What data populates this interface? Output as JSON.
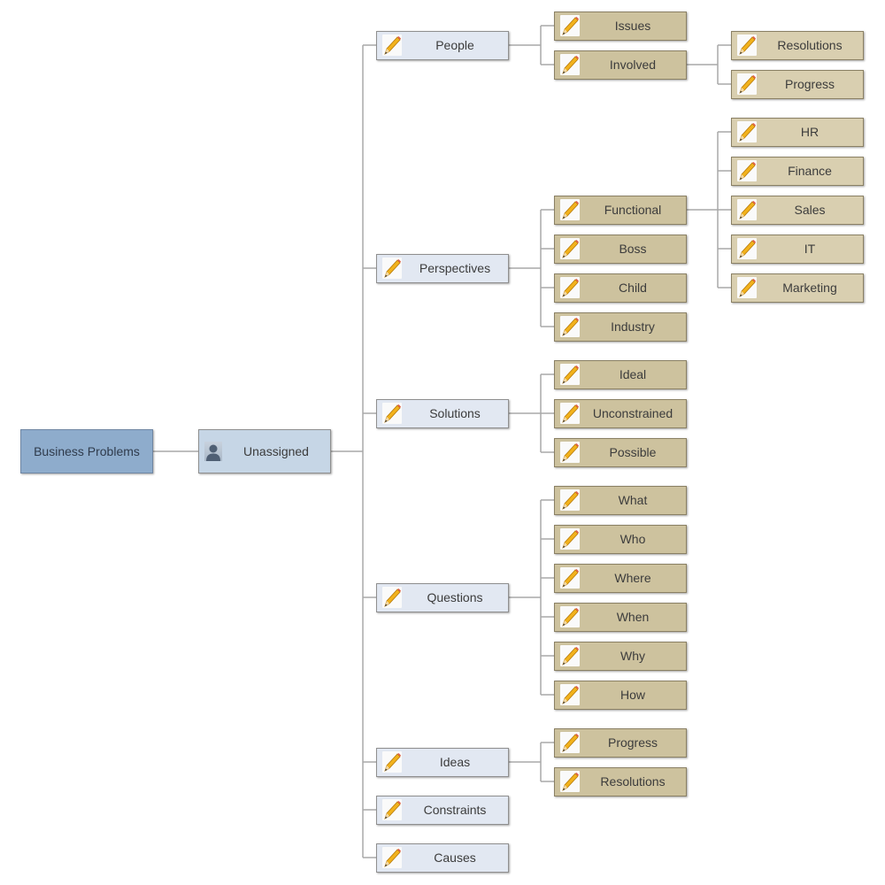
{
  "colors": {
    "root": "#8eaccc",
    "unassigned": "#c6d6e6",
    "branch": "#e2e8f2",
    "subtopic": "#cdc29e",
    "subsubtopic": "#d9cfb0",
    "connector": "#a8a8a8"
  },
  "root": {
    "label": "Business Problems"
  },
  "hub": {
    "label": "Unassigned",
    "icon": "person-icon"
  },
  "branches": [
    {
      "label": "People",
      "icon": "pencil-icon",
      "children": [
        {
          "label": "Issues"
        },
        {
          "label": "Involved",
          "children": [
            {
              "label": "Resolutions"
            },
            {
              "label": "Progress"
            }
          ]
        }
      ]
    },
    {
      "label": "Perspectives",
      "icon": "pencil-icon",
      "children": [
        {
          "label": "Functional",
          "children": [
            {
              "label": "HR"
            },
            {
              "label": "Finance"
            },
            {
              "label": "Sales"
            },
            {
              "label": "IT"
            },
            {
              "label": "Marketing"
            }
          ]
        },
        {
          "label": "Boss"
        },
        {
          "label": "Child"
        },
        {
          "label": "Industry"
        }
      ]
    },
    {
      "label": "Solutions",
      "icon": "pencil-icon",
      "children": [
        {
          "label": "Ideal"
        },
        {
          "label": "Unconstrained"
        },
        {
          "label": "Possible"
        }
      ]
    },
    {
      "label": "Questions",
      "icon": "pencil-icon",
      "children": [
        {
          "label": "What"
        },
        {
          "label": "Who"
        },
        {
          "label": "Where"
        },
        {
          "label": "When"
        },
        {
          "label": "Why"
        },
        {
          "label": "How"
        }
      ]
    },
    {
      "label": "Ideas",
      "icon": "pencil-icon",
      "children": [
        {
          "label": "Progress"
        },
        {
          "label": "Resolutions"
        }
      ]
    },
    {
      "label": "Constraints",
      "icon": "pencil-icon"
    },
    {
      "label": "Causes",
      "icon": "pencil-icon"
    }
  ]
}
